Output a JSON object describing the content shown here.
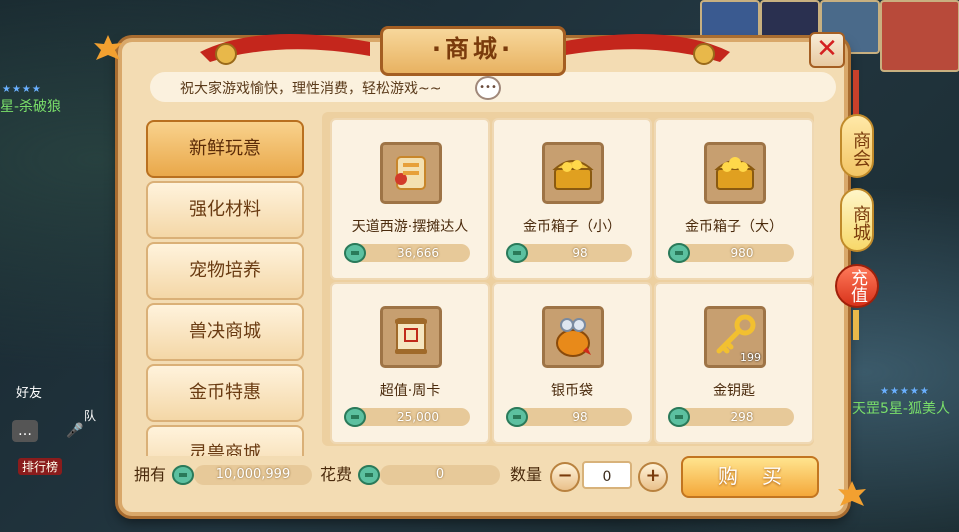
{
  "window": {
    "title": "·商城·",
    "close_label": "✕"
  },
  "notice": {
    "text": "祝大家游戏愉快，理性消费，轻松游戏~~",
    "icon": "chat-bubble-icon"
  },
  "categories": [
    {
      "label": "新鲜玩意",
      "active": true
    },
    {
      "label": "强化材料",
      "active": false
    },
    {
      "label": "宠物培养",
      "active": false
    },
    {
      "label": "兽决商城",
      "active": false
    },
    {
      "label": "金币特惠",
      "active": false
    },
    {
      "label": "灵兽商城",
      "active": false
    }
  ],
  "items": [
    {
      "name": "天道西游·摆摊达人",
      "price": "36,666",
      "icon": "scroll-ticket-icon",
      "count": ""
    },
    {
      "name": "金币箱子（小）",
      "price": "98",
      "icon": "gold-chest-icon",
      "count": ""
    },
    {
      "name": "金币箱子（大）",
      "price": "980",
      "icon": "gold-chest-icon",
      "count": ""
    },
    {
      "name": "超值·周卡",
      "price": "25,000",
      "icon": "weekly-card-scroll-icon",
      "count": ""
    },
    {
      "name": "银币袋",
      "price": "98",
      "icon": "coin-bag-icon",
      "count": ""
    },
    {
      "name": "金钥匙",
      "price": "298",
      "icon": "gold-key-icon",
      "count": "199"
    }
  ],
  "footer": {
    "owned_label": "拥有",
    "owned_value": "10,000,999",
    "cost_label": "花费",
    "cost_value": "0",
    "qty_label": "数量",
    "qty_value": "0",
    "minus_label": "−",
    "plus_label": "+",
    "buy_label": "购买"
  },
  "side_tabs": [
    {
      "label": "商会"
    },
    {
      "label": "商城"
    },
    {
      "label": "充值"
    }
  ],
  "background": {
    "player_left": "星-杀破狼",
    "player_right": "天罡5星-狐美人",
    "friends_label": "好友",
    "rank_label": "排行榜",
    "queue_label": "队"
  },
  "colors": {
    "window_bg": "#f3dcb3",
    "accent": "#e9a84a",
    "close_red": "#d42020",
    "price_coin": "#4aa88a"
  }
}
